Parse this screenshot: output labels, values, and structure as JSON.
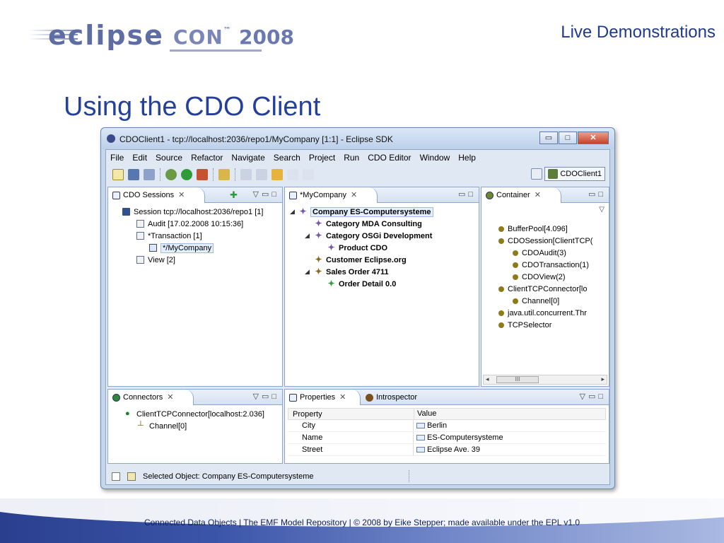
{
  "slide": {
    "top_right": "Live Demonstrations",
    "title": "Using the CDO Client",
    "footer": "Connected Data Objects  |  The EMF Model Repository  |  © 2008 by Eike Stepper; made available under the EPL v1.0"
  },
  "logo": {
    "brand": "eclipse",
    "con": "CON",
    "tm": "™",
    "year": "2008"
  },
  "window": {
    "title": "CDOClient1 - tcp://localhost:2036/repo1/MyCompany [1:1] - Eclipse SDK",
    "btn_min": "▭",
    "btn_max": "□",
    "btn_close": "✕"
  },
  "menu": [
    "File",
    "Edit",
    "Source",
    "Refactor",
    "Navigate",
    "Search",
    "Project",
    "Run",
    "CDO Editor",
    "Window",
    "Help"
  ],
  "perspective": "CDOClient1",
  "sessions": {
    "tab": "CDO Sessions",
    "items": [
      "Session tcp://localhost:2036/repo1 [1]",
      "Audit [17.02.2008 10:15:36]",
      "*Transaction [1]",
      "*/MyCompany",
      "View [2]"
    ]
  },
  "editor": {
    "tab": "*MyCompany",
    "items": [
      "Company ES-Computersysteme",
      "Category MDA Consulting",
      "Category OSGi Development",
      "Product CDO",
      "Customer Eclipse.org",
      "Sales Order 4711",
      "Order Detail 0.0"
    ]
  },
  "container": {
    "tab": "Container",
    "items": [
      "BufferPool[4.096]",
      "CDOSession[ClientTCP(",
      "CDOAudit(3)",
      "CDOTransaction(1)",
      "CDOView(2)",
      "ClientTCPConnector[lo",
      "Channel[0]",
      "java.util.concurrent.Thr",
      "TCPSelector"
    ],
    "scroll_thumb": "III"
  },
  "connectors": {
    "tab": "Connectors",
    "items": [
      "ClientTCPConnector[localhost:2.036]",
      "Channel[0]"
    ]
  },
  "properties": {
    "tab": "Properties",
    "tab2": "Introspector",
    "head_property": "Property",
    "head_value": "Value",
    "rows": [
      {
        "property": "City",
        "value": "Berlin"
      },
      {
        "property": "Name",
        "value": "ES-Computersysteme"
      },
      {
        "property": "Street",
        "value": "Eclipse Ave. 39"
      }
    ]
  },
  "status": {
    "text": "Selected Object: Company ES-Computersysteme"
  },
  "icons": {
    "close_tab": "✕",
    "view_menu": "▽",
    "min": "▭",
    "max": "□",
    "expand": "◢",
    "add": "✚"
  }
}
